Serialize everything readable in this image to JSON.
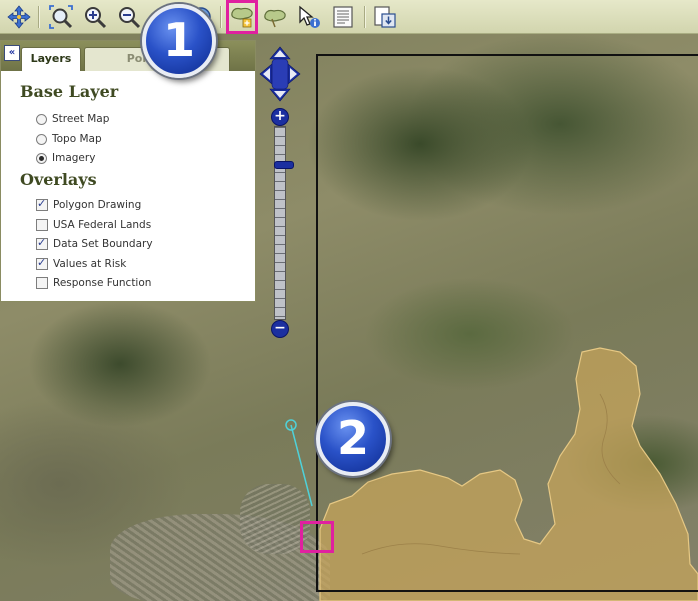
{
  "toolbar": {
    "tools": [
      {
        "icon": "pan-arrows-icon"
      },
      {
        "icon": "zoom-extent-icon"
      },
      {
        "icon": "zoom-in-icon"
      },
      {
        "icon": "zoom-out-icon"
      },
      {
        "icon": "globe-icon"
      },
      {
        "icon": "draw-polygon-icon"
      },
      {
        "icon": "select-polygon-icon"
      },
      {
        "icon": "identify-icon"
      },
      {
        "icon": "report-icon"
      },
      {
        "icon": "export-icon"
      }
    ],
    "highlight_color": "#e020a0"
  },
  "panel": {
    "collapse_label": "«",
    "tabs": [
      {
        "label": "Layers",
        "active": true
      },
      {
        "label": "Point Info",
        "active": false
      }
    ],
    "base_layer": {
      "title": "Base Layer",
      "options": [
        {
          "label": "Street Map",
          "selected": false
        },
        {
          "label": "Topo Map",
          "selected": false
        },
        {
          "label": "Imagery",
          "selected": true
        }
      ]
    },
    "overlays": {
      "title": "Overlays",
      "options": [
        {
          "label": "Polygon Drawing",
          "checked": true
        },
        {
          "label": "USA Federal Lands",
          "checked": false
        },
        {
          "label": "Data Set Boundary",
          "checked": true
        },
        {
          "label": "Values at Risk",
          "checked": true
        },
        {
          "label": "Response Function",
          "checked": false
        }
      ]
    }
  },
  "zoom": {
    "in_label": "+",
    "out_label": "−"
  },
  "annotations": {
    "step1": "1",
    "step2": "2",
    "badge_color": "#2a52c8"
  }
}
